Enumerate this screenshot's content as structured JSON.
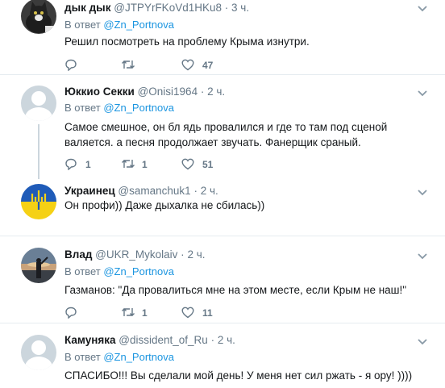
{
  "tweets": [
    {
      "name": "дык дык",
      "handle": "@JTPYrFKoVd1HKu8",
      "time": "3 ч.",
      "reply_prefix": "В ответ",
      "reply_to": "@Zn_Portnova",
      "text": "Решил посмотреть на проблему Крыма изнутри.",
      "replies": "",
      "retweets": "",
      "likes": "47"
    },
    {
      "name": "Юккио Секки",
      "handle": "@Onisi1964",
      "time": "2 ч.",
      "reply_prefix": "В ответ",
      "reply_to": "@Zn_Portnova",
      "text": "Самое смешное, он бл ядь провалился и где то там под сценой валяется. а песня продолжает звучать. Фанерщик сраный.",
      "replies": "1",
      "retweets": "1",
      "likes": "51"
    },
    {
      "name": "Украинец",
      "handle": "@samanchuk1",
      "time": "2 ч.",
      "text": "Он профи)) Даже дыхалка не сбилась))"
    },
    {
      "name": "Влад",
      "handle": "@UKR_Mykolaiv",
      "time": "2 ч.",
      "reply_prefix": "В ответ",
      "reply_to": "@Zn_Portnova",
      "text": "Газманов: \"Да провалиться мне на этом месте, если Крым не наш!\"",
      "replies": "",
      "retweets": "1",
      "likes": "11"
    },
    {
      "name": "Камуняка",
      "handle": "@dissident_of_Ru",
      "time": "2 ч.",
      "reply_prefix": "В ответ",
      "reply_to": "@Zn_Portnova",
      "text": "СПАСИБО!!! Вы сделали мой день! У меня нет сил ржать - я ору! ))))"
    }
  ],
  "dot": "·",
  "icons": [
    "reply-icon",
    "retweet-icon",
    "like-icon",
    "caret-down-icon",
    "avatar-cat",
    "avatar-default",
    "avatar-ukraine-trident",
    "avatar-photo"
  ],
  "colors": {
    "link": "#1b95e0",
    "muted": "#657786",
    "separator": "#e6ecf0",
    "text": "#14171a"
  }
}
